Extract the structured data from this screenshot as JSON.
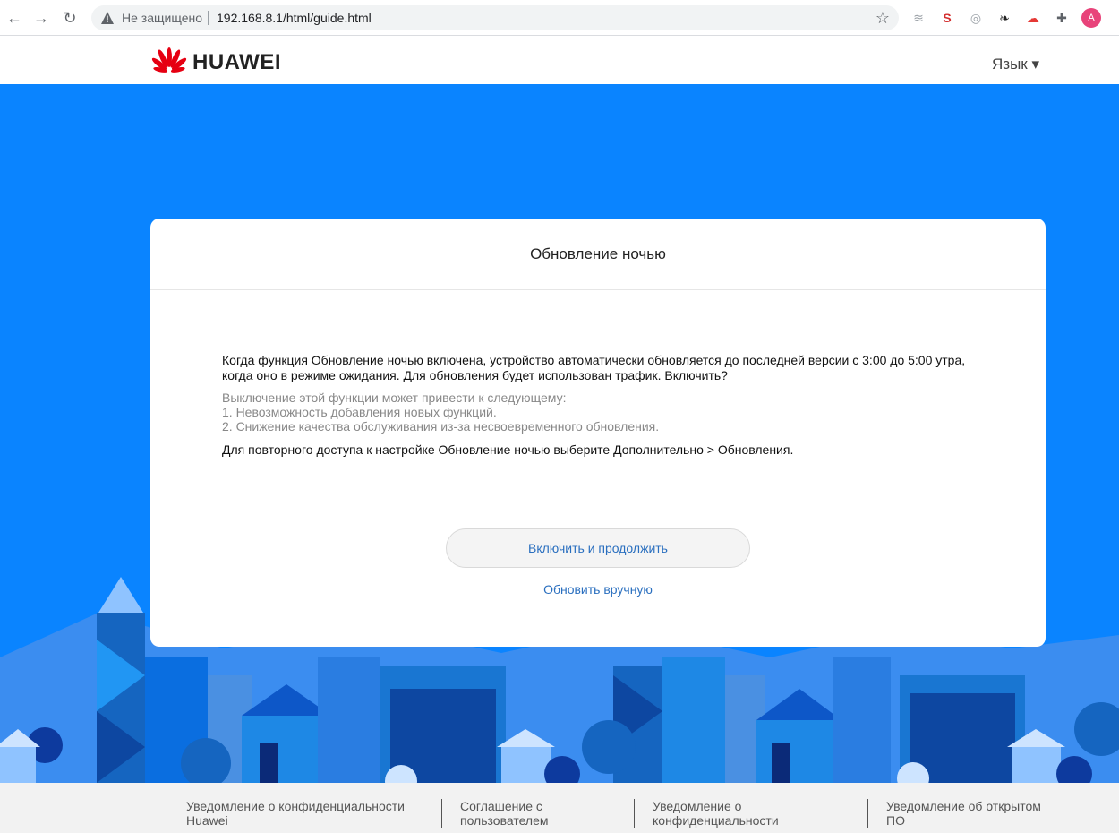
{
  "browser": {
    "not_secure": "Не защищено",
    "url": "192.168.8.1/html/guide.html",
    "avatar_letter": "A"
  },
  "header": {
    "brand": "HUAWEI",
    "language": "Язык ▾"
  },
  "card": {
    "title": "Обновление ночью",
    "main_text": "Когда функция Обновление ночью включена, устройство автоматически обновляется до последней версии с 3:00 до 5:00 утра, когда оно в режиме ожидания. Для обновления будет использован трафик. Включить?",
    "grey_lines": [
      "Выключение этой функции может привести к следующему:",
      "1. Невозможность добавления новых функций.",
      "2. Снижение качества обслуживания из-за несвоевременного обновления."
    ],
    "note": "Для повторного доступа к настройке Обновление ночью выберите Дополнительно > Обновления.",
    "primary_button": "Включить и продолжить",
    "secondary_link": "Обновить вручную"
  },
  "footer": {
    "items": [
      "Уведомление о конфиденциальности Huawei",
      "Соглашение с пользователем",
      "Уведомление о конфиденциальности",
      "Уведомление об открытом ПО"
    ]
  },
  "colors": {
    "page_blue": "#0a84ff",
    "link_blue": "#2a6fbf",
    "brand_red": "#e60012"
  }
}
